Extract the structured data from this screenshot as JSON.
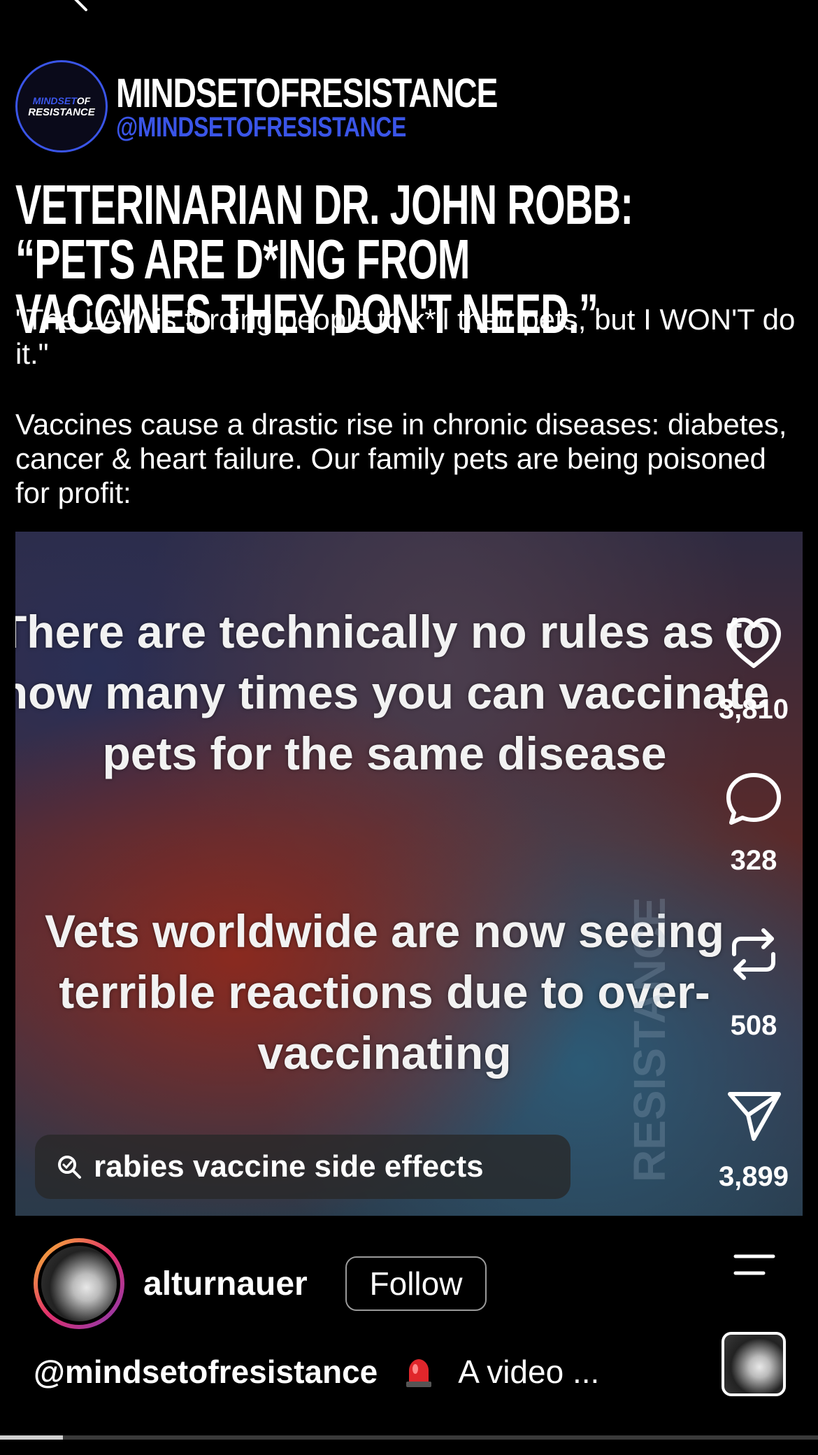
{
  "post": {
    "brand_logo_line1_a": "MINDSET",
    "brand_logo_line1_b": "OF",
    "brand_logo_line2": "RESISTANCE",
    "brand_name": "MINDSETOFRESISTANCE",
    "brand_handle": "@MINDSETOFRESISTANCE",
    "headline": "VETERINARIAN DR. JOHN ROBB: “PETS ARE D*ING FROM VACCINES THEY DON'T NEED.”",
    "quote": "\"The LAW is forcing people to k*ll their pets, but I WON'T do it.\"",
    "body": "Vaccines cause a drastic rise in chronic diseases: diabetes, cancer & heart failure. Our family pets are being poisoned for profit:"
  },
  "video": {
    "text_block_1": "There are technically no rules as to how many times you can vaccinate pets for the same disease",
    "text_block_2": "Vets worldwide are now seeing terrible reactions due to over-vaccinating",
    "watermark": "RESISTANCE",
    "search_chip_label": "rabies vaccine side effects"
  },
  "actions": {
    "likes": "3,810",
    "comments": "328",
    "reposts": "508",
    "shares": "3,899"
  },
  "author": {
    "username": "alturnauer",
    "follow_label": "Follow"
  },
  "caption": {
    "handle": "@mindsetofresistance",
    "text": "A video ..."
  },
  "progress": 0.077,
  "colors": {
    "brand_blue": "#3a55e8",
    "background": "#000000"
  },
  "icons": [
    "back-chevron-icon",
    "search-icon",
    "heart-icon",
    "comment-icon",
    "repost-icon",
    "share-icon",
    "menu-icon",
    "siren-emoji-icon"
  ]
}
